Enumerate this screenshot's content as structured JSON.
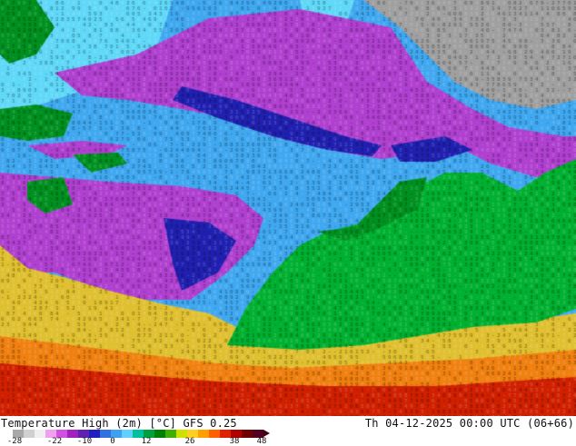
{
  "caption": {
    "left": "Temperature High (2m) [°C] GFS 0.25",
    "right": "Th 04-12-2025 00:00 UTC (06+66)"
  },
  "colorbar": {
    "colors": [
      "#a8a8a8",
      "#d0d0d0",
      "#f0f0f0",
      "#f0a0f0",
      "#d050e0",
      "#a020c0",
      "#6020b0",
      "#2020c0",
      "#3070e0",
      "#40a0f0",
      "#60d0ff",
      "#00c0a0",
      "#00a040",
      "#008000",
      "#40b000",
      "#d0e000",
      "#ffd020",
      "#ffa000",
      "#ff6000",
      "#e02000",
      "#b00000",
      "#700000",
      "#500020"
    ],
    "ticks": [
      "-28",
      "-22",
      "-10",
      "0",
      "12",
      "26",
      "38",
      "48"
    ],
    "tip_color": "#400010"
  },
  "map": {
    "zones": {
      "arctic_ocean": "#a0a0a0",
      "cold_land": "#b040d0",
      "very_cold_land": "#2020b0",
      "sea_cold": "#40a8f0",
      "sea_mild": "#60d8f8",
      "sea_warm": "#00c0c0",
      "tundra_green": "#009020",
      "forest_green": "#00b030",
      "warm_land": "#e0c030",
      "hot_land": "#f08010",
      "hottest_land": "#d02000"
    },
    "label_glyphs": "0123456789-"
  }
}
